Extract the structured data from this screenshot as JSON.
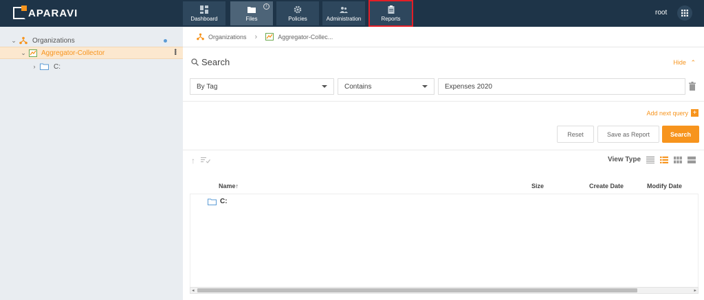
{
  "brand": {
    "name": "APARAVI"
  },
  "nav": {
    "items": [
      {
        "label": "Dashboard",
        "icon": "dashboard-icon"
      },
      {
        "label": "Files",
        "icon": "folder-icon"
      },
      {
        "label": "Policies",
        "icon": "gear-icon"
      },
      {
        "label": "Administration",
        "icon": "users-icon"
      },
      {
        "label": "Reports",
        "icon": "clipboard-icon"
      }
    ],
    "active": "Files",
    "highlighted": "Reports",
    "files_badge": "i"
  },
  "user": {
    "name": "root"
  },
  "sidebar": {
    "tree": [
      {
        "label": "Organizations",
        "icon": "organizations-icon",
        "expanded": true
      },
      {
        "label": "Aggregator-Collector",
        "icon": "aggregator-icon",
        "expanded": true,
        "selected": true
      },
      {
        "label": "C:",
        "icon": "folder-icon",
        "expanded": false
      }
    ]
  },
  "breadcrumb": {
    "items": [
      {
        "label": "Organizations"
      },
      {
        "label": "Aggregator-Collec..."
      }
    ]
  },
  "search": {
    "title": "Search",
    "hide_label": "Hide",
    "field_type": "By Tag",
    "operator": "Contains",
    "value": "Expenses 2020",
    "add_next_query": "Add next query",
    "reset_label": "Reset",
    "save_report_label": "Save as Report",
    "search_label": "Search"
  },
  "results": {
    "view_type_label": "View Type",
    "columns": [
      "Name",
      "Size",
      "Create Date",
      "Modify Date"
    ],
    "rows": [
      {
        "name": "C:",
        "size": "",
        "create_date": "",
        "modify_date": ""
      }
    ]
  },
  "colors": {
    "topbar": "#1e3448",
    "accent": "#f7941d",
    "sidebar": "#e9edf1",
    "highlight_box": "#e41e26"
  }
}
